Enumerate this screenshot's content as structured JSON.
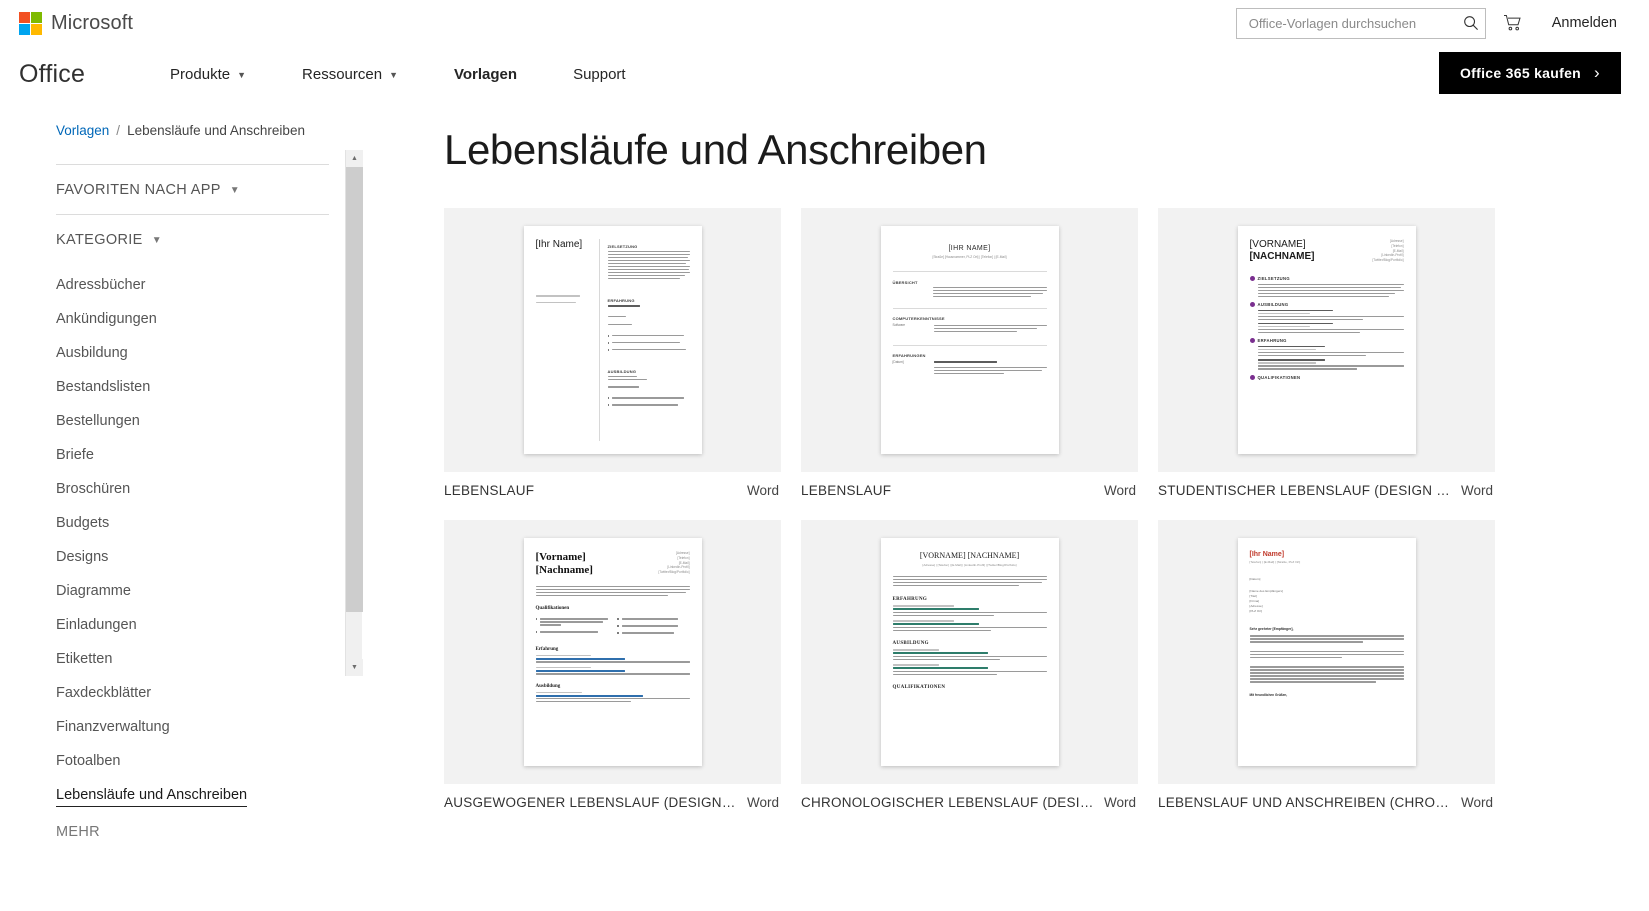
{
  "msbar": {
    "logo_label": "Microsoft",
    "logo_colors": [
      "#f25022",
      "#7fba00",
      "#00a4ef",
      "#ffb900"
    ],
    "search": {
      "placeholder": "Office-Vorlagen durchsuchen",
      "value": ""
    },
    "search_icon": "search-icon",
    "cart_icon": "cart-icon",
    "signin_label": "Anmelden"
  },
  "officenav": {
    "brand": "Office",
    "items": [
      {
        "label": "Produkte",
        "has_caret": true,
        "active": false
      },
      {
        "label": "Ressourcen",
        "has_caret": true,
        "active": false
      },
      {
        "label": "Vorlagen",
        "has_caret": false,
        "active": true
      },
      {
        "label": "Support",
        "has_caret": false,
        "active": false
      }
    ],
    "buy_button": {
      "label": "Office 365 kaufen",
      "chevron": "›",
      "bg": "#000000",
      "fg": "#ffffff"
    }
  },
  "breadcrumb": {
    "root": "Vorlagen",
    "separator": "/",
    "current": "Lebensläufe und Anschreiben",
    "link_color": "#0067b8"
  },
  "sidebar": {
    "facets": [
      {
        "label": "FAVORITEN NACH APP",
        "caret": "chevron-down-icon"
      },
      {
        "label": "KATEGORIE",
        "caret": "chevron-down-icon"
      }
    ],
    "categories": [
      {
        "label": "Adressbücher",
        "selected": false
      },
      {
        "label": "Ankündigungen",
        "selected": false
      },
      {
        "label": "Ausbildung",
        "selected": false
      },
      {
        "label": "Bestandslisten",
        "selected": false
      },
      {
        "label": "Bestellungen",
        "selected": false
      },
      {
        "label": "Briefe",
        "selected": false
      },
      {
        "label": "Broschüren",
        "selected": false
      },
      {
        "label": "Budgets",
        "selected": false
      },
      {
        "label": "Designs",
        "selected": false
      },
      {
        "label": "Diagramme",
        "selected": false
      },
      {
        "label": "Einladungen",
        "selected": false
      },
      {
        "label": "Etiketten",
        "selected": false
      },
      {
        "label": "Faxdeckblätter",
        "selected": false
      },
      {
        "label": "Finanzverwaltung",
        "selected": false
      },
      {
        "label": "Fotoalben",
        "selected": false
      },
      {
        "label": "Lebensläufe und Anschreiben",
        "selected": true
      }
    ],
    "more_label": "MEHR",
    "scrollbar": {
      "up_arrow": "▲",
      "down_arrow": "▼"
    }
  },
  "main": {
    "title": "Lebensläufe und Anschreiben",
    "cards": [
      {
        "title": "LEBENSLAUF",
        "app": "Word",
        "preview": {
          "style": "two-column",
          "name": "[Ihr Name]",
          "left_items": [
            "[Position]",
            "[Position]"
          ],
          "sections": [
            "ZIELSETZUNG",
            "ERFAHRUNG",
            "AUSBILDUNG"
          ],
          "fields": [
            "[Daten von - bis]",
            "[Firma]",
            "[Position]",
            "[Name der Schule, Ort]",
            "[Schulabschluss]"
          ],
          "bullets": [
            "Klicken Sie hier, um Text einzugeben.",
            "Klicken Sie hier, um Text einzugeben.",
            "Klicken Sie hier, um Text einzugeben."
          ]
        }
      },
      {
        "title": "LEBENSLAUF",
        "app": "Word",
        "preview": {
          "style": "centered",
          "name": "[IHR NAME]",
          "subtitle": "[Straße] [Hausnummer, PLZ Ort] | [Telefon] | [E-Mail]",
          "sections": [
            "ÜBERSICHT",
            "COMPUTERKENNTNISSE",
            "ERFAHRUNGEN"
          ],
          "fields": [
            "Software",
            "[Datum]"
          ]
        }
      },
      {
        "title": "STUDENTISCHER LEBENSLAUF (DESIGN \"M...",
        "app": "Word",
        "preview": {
          "style": "purple-icons",
          "name_line1": "[VORNAME]",
          "name_line2": "[NACHNAME]",
          "meta": [
            "[Adresse]",
            "[Telefon]",
            "[E-Mail]",
            "[LinkedIn-Profil]",
            "[Twitter/Blog/Portfolio]"
          ],
          "sections": [
            "ZIELSETZUNG",
            "AUSBILDUNG",
            "ERFAHRUNG",
            "QUALIFIKATIONEN"
          ],
          "fields": [
            "[Abschluss als] | [Schule]",
            "[BESUCHT VON] – [BIS]",
            "[Position] | [Firma]",
            "[BESCHÄFTIGT VON] – [BIS]"
          ],
          "accent": "#7a2f8f"
        }
      },
      {
        "title": "AUSGEWOGENER LEBENSLAUF (DESIGN \"M...",
        "app": "Word",
        "preview": {
          "style": "serif-blue",
          "name_line1": "[Vorname]",
          "name_line2": "[Nachname]",
          "meta": [
            "[Adresse]",
            "[Telefon]",
            "[E-Mail]",
            "[LinkedIn-Profil]",
            "[Twitter/Blog/Portfolio]"
          ],
          "sections": [
            "Qualifikationen",
            "Erfahrung",
            "Ausbildung"
          ],
          "fields": [
            "[Position] / [Firma, Ort]",
            "[MONAT JAHR]",
            "[Abschluss als] / [Bildungseinrichtung, Ort]"
          ],
          "accent": "#2f6fad"
        }
      },
      {
        "title": "CHRONOLOGISCHER LEBENSLAUF (DESIGN ...",
        "app": "Word",
        "preview": {
          "style": "serif-green",
          "name": "[VORNAME] [NACHNAME]",
          "subtitle": "[Adresse] | [Telefon] | [E-Mail] | [LinkedIn-Profil] | [Twitter/Blog/Portfolio]",
          "sections": [
            "ERFAHRUNG",
            "AUSBILDUNG",
            "QUALIFIKATIONEN"
          ],
          "fields": [
            "[BESCHÄFTIGT VON] – [BIS]",
            "[POSITION] | [FIRMA]",
            "[MONAT JAHR]",
            "[ABSCHLUSS ALS] | [SCHULE]"
          ],
          "accent": "#2e7d6b"
        }
      },
      {
        "title": "LEBENSLAUF UND ANSCHREIBEN (CHRONO...",
        "app": "Word",
        "preview": {
          "style": "letter-red",
          "name": "[Ihr Name]",
          "subtitle": "[Telefon] | [E-Mail] | [Straße, PLZ Ort]",
          "fields": [
            "[Datum]",
            "[Name des Empfängers]",
            "[Titel]",
            "[Firma]",
            "[Adresse]",
            "[PLZ Ort]"
          ],
          "salutation": "Sehr geehrter [Empfänger],",
          "closing": "Mit freundlichen Grüßen,",
          "accent": "#c0392b"
        }
      }
    ]
  }
}
